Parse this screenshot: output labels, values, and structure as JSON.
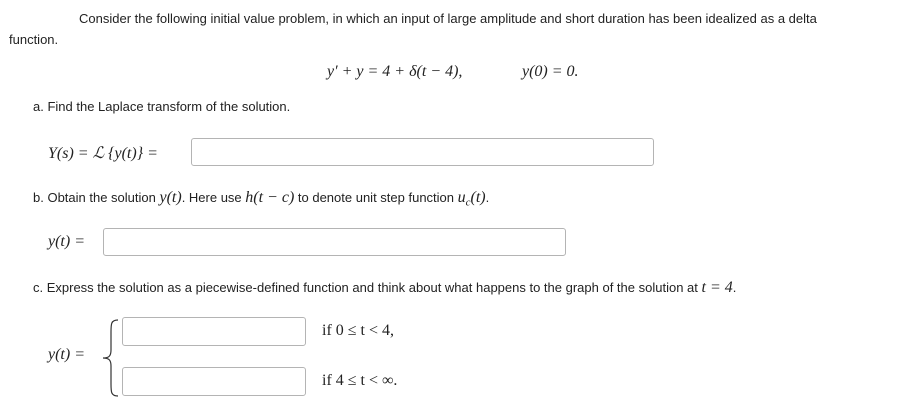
{
  "intro": {
    "line1": "Consider the following initial value problem, in which an input of large amplitude and short duration has been idealized as a delta",
    "line2": "function."
  },
  "ivp": {
    "equation": "y′ + y = 4 + δ(t − 4),",
    "initial_condition": "y(0) = 0."
  },
  "part_a": {
    "prompt": "a. Find the Laplace transform of the solution.",
    "lhs": "Y(s) = ℒ {y(t)} =",
    "answer_value": ""
  },
  "part_b": {
    "prompt_start": "b. Obtain the solution ",
    "prompt_y": "y(t)",
    "prompt_mid": ". Here use ",
    "prompt_h": "h(t − c)",
    "prompt_mid2": " to denote unit step function ",
    "prompt_u": "u",
    "prompt_u_sub": "c",
    "prompt_u_arg": "(t)",
    "prompt_end": ".",
    "lhs": "y(t) =",
    "answer_value": ""
  },
  "part_c": {
    "prompt_start": "c. Express the solution as a piecewise-defined function and think about what happens to the graph of the solution at ",
    "prompt_math": "t = 4",
    "prompt_end": ".",
    "lhs": "y(t) =",
    "piece1_condition": "if 0 ≤ t < 4,",
    "piece2_condition": "if 4 ≤ t < ∞.",
    "piece1_value": "",
    "piece2_value": ""
  }
}
